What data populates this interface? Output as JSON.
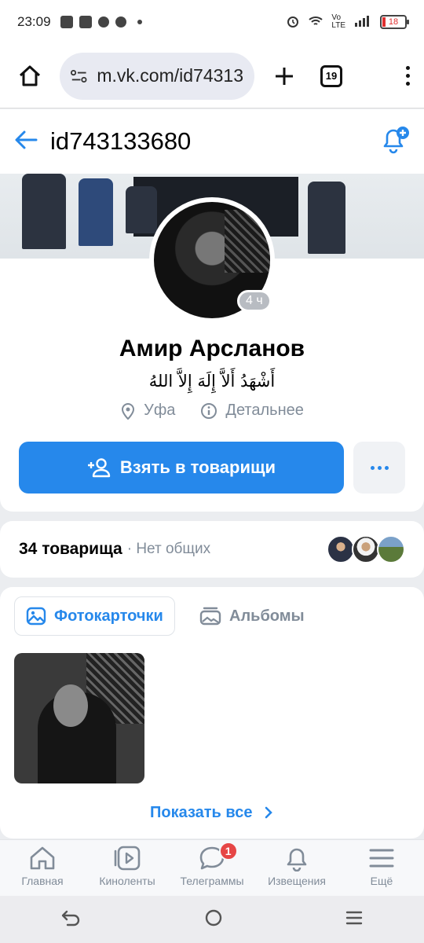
{
  "status_bar": {
    "time": "23:09",
    "battery": "18"
  },
  "browser": {
    "url": "m.vk.com/id74313",
    "tab_count": "19"
  },
  "header": {
    "title": "id743133680"
  },
  "profile": {
    "name": "Амир Арсланов",
    "status": "أَشْهَدُ أَلاَّ إِلَهَ إِلاَّ اللهُ",
    "online": "4 ч",
    "city": "Уфа",
    "details": "Детальнее",
    "add_button": "Взять в товарищи"
  },
  "friends": {
    "count": "34 товарища",
    "common": "· Нет общих"
  },
  "photos": {
    "tab_photos": "Фотокарточки",
    "tab_albums": "Альбомы",
    "show_all": "Показать все"
  },
  "bottom_nav": [
    {
      "label": "Главная",
      "icon": "home-icon"
    },
    {
      "label": "Киноленты",
      "icon": "video-icon"
    },
    {
      "label": "Телеграммы",
      "icon": "messages-icon",
      "badge": "1"
    },
    {
      "label": "Извещения",
      "icon": "bell-icon"
    },
    {
      "label": "Ещё",
      "icon": "menu-icon"
    }
  ],
  "colors": {
    "accent": "#2688eb",
    "secondary_text": "#818c99",
    "badge": "#e64646"
  }
}
